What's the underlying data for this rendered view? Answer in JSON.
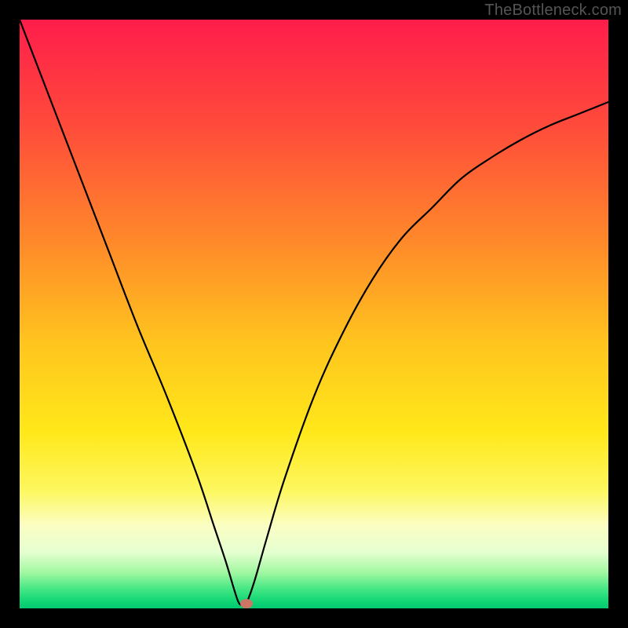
{
  "watermark": "TheBottleneck.com",
  "chart_data": {
    "type": "line",
    "title": "",
    "xlabel": "",
    "ylabel": "",
    "xlim": [
      0,
      100
    ],
    "ylim": [
      0,
      100
    ],
    "grid": false,
    "legend": false,
    "background_gradient": {
      "stops": [
        {
          "pos": 0.0,
          "color": "#ff1d4b"
        },
        {
          "pos": 0.18,
          "color": "#ff4b3b"
        },
        {
          "pos": 0.38,
          "color": "#ff8a2a"
        },
        {
          "pos": 0.55,
          "color": "#ffc51e"
        },
        {
          "pos": 0.7,
          "color": "#ffe81a"
        },
        {
          "pos": 0.8,
          "color": "#fdf760"
        },
        {
          "pos": 0.86,
          "color": "#fbfec4"
        },
        {
          "pos": 0.905,
          "color": "#e5ffd0"
        },
        {
          "pos": 0.94,
          "color": "#9ff7a0"
        },
        {
          "pos": 0.965,
          "color": "#4be886"
        },
        {
          "pos": 0.985,
          "color": "#17d877"
        },
        {
          "pos": 1.0,
          "color": "#00c971"
        }
      ]
    },
    "series": [
      {
        "name": "bottleneck-curve",
        "x": [
          0,
          5,
          10,
          15,
          20,
          25,
          30,
          33,
          35,
          36.5,
          37.2,
          37.8,
          38.2,
          38.8,
          40,
          42,
          45,
          50,
          55,
          60,
          65,
          70,
          75,
          80,
          85,
          90,
          95,
          100
        ],
        "y": [
          100,
          87,
          74,
          61,
          48,
          36,
          23,
          14,
          8,
          3,
          1,
          0.5,
          0.5,
          1.5,
          5,
          12,
          22,
          36,
          47,
          56,
          63,
          68,
          73,
          76.5,
          79.5,
          82,
          84,
          86
        ]
      }
    ],
    "marker": {
      "name": "bottleneck-point",
      "x": 38.5,
      "y": 0.8,
      "color": "#cc7766",
      "rx": 8,
      "ry": 6
    }
  }
}
